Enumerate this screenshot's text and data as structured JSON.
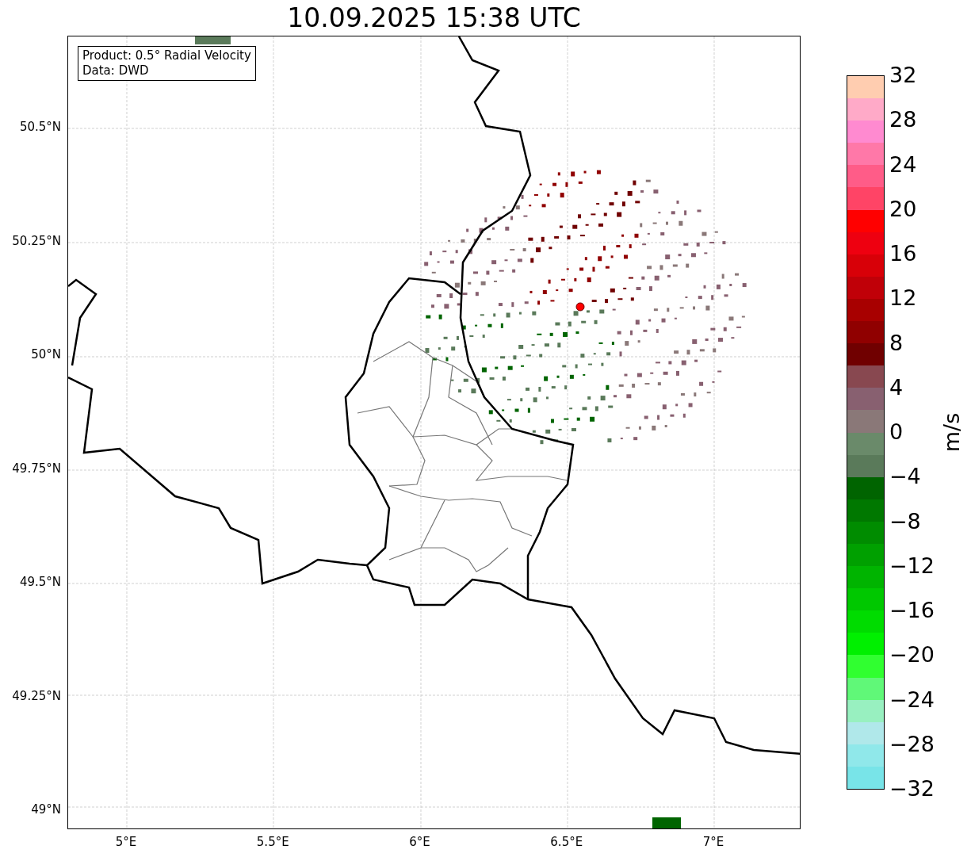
{
  "title": "10.09.2025 15:38 UTC",
  "info_box": [
    "Product: 0.5° Radial Velocity",
    "Data: DWD"
  ],
  "y_ticks": [
    "50.5°N",
    "50.25°N",
    "50°N",
    "49.75°N",
    "49.5°N",
    "49.25°N",
    "49°N"
  ],
  "x_ticks": [
    "5°E",
    "5.5°E",
    "6°E",
    "6.5°E",
    "7°E"
  ],
  "colorbar": {
    "label": "m/s",
    "ticks": [
      "32",
      "28",
      "24",
      "20",
      "16",
      "12",
      "8",
      "4",
      "0",
      "−4",
      "−8",
      "−12",
      "−16",
      "−20",
      "−24",
      "−28",
      "−32"
    ],
    "segments": [
      {
        "color": "#ffcdb0"
      },
      {
        "color": "#ffaac8"
      },
      {
        "color": "#ff8ad0"
      },
      {
        "color": "#ff78a8"
      },
      {
        "color": "#ff5c88"
      },
      {
        "color": "#ff4466"
      },
      {
        "color": "#ff0000"
      },
      {
        "color": "#ee0010"
      },
      {
        "color": "#d80008"
      },
      {
        "color": "#c00008"
      },
      {
        "color": "#a80000"
      },
      {
        "color": "#900000"
      },
      {
        "color": "#700000"
      },
      {
        "color": "#884850"
      },
      {
        "color": "#886070"
      },
      {
        "color": "#8a7878"
      },
      {
        "color": "#6a8a6a"
      },
      {
        "color": "#5a7a5a"
      },
      {
        "color": "#006400"
      },
      {
        "color": "#007800"
      },
      {
        "color": "#008c00"
      },
      {
        "color": "#00a000"
      },
      {
        "color": "#00b400"
      },
      {
        "color": "#00c800"
      },
      {
        "color": "#00dc00"
      },
      {
        "color": "#00f000"
      },
      {
        "color": "#30ff30"
      },
      {
        "color": "#60f878"
      },
      {
        "color": "#98f0c0"
      },
      {
        "color": "#b0e8ea"
      },
      {
        "color": "#90e8ea"
      },
      {
        "color": "#78e4e8"
      }
    ]
  }
}
